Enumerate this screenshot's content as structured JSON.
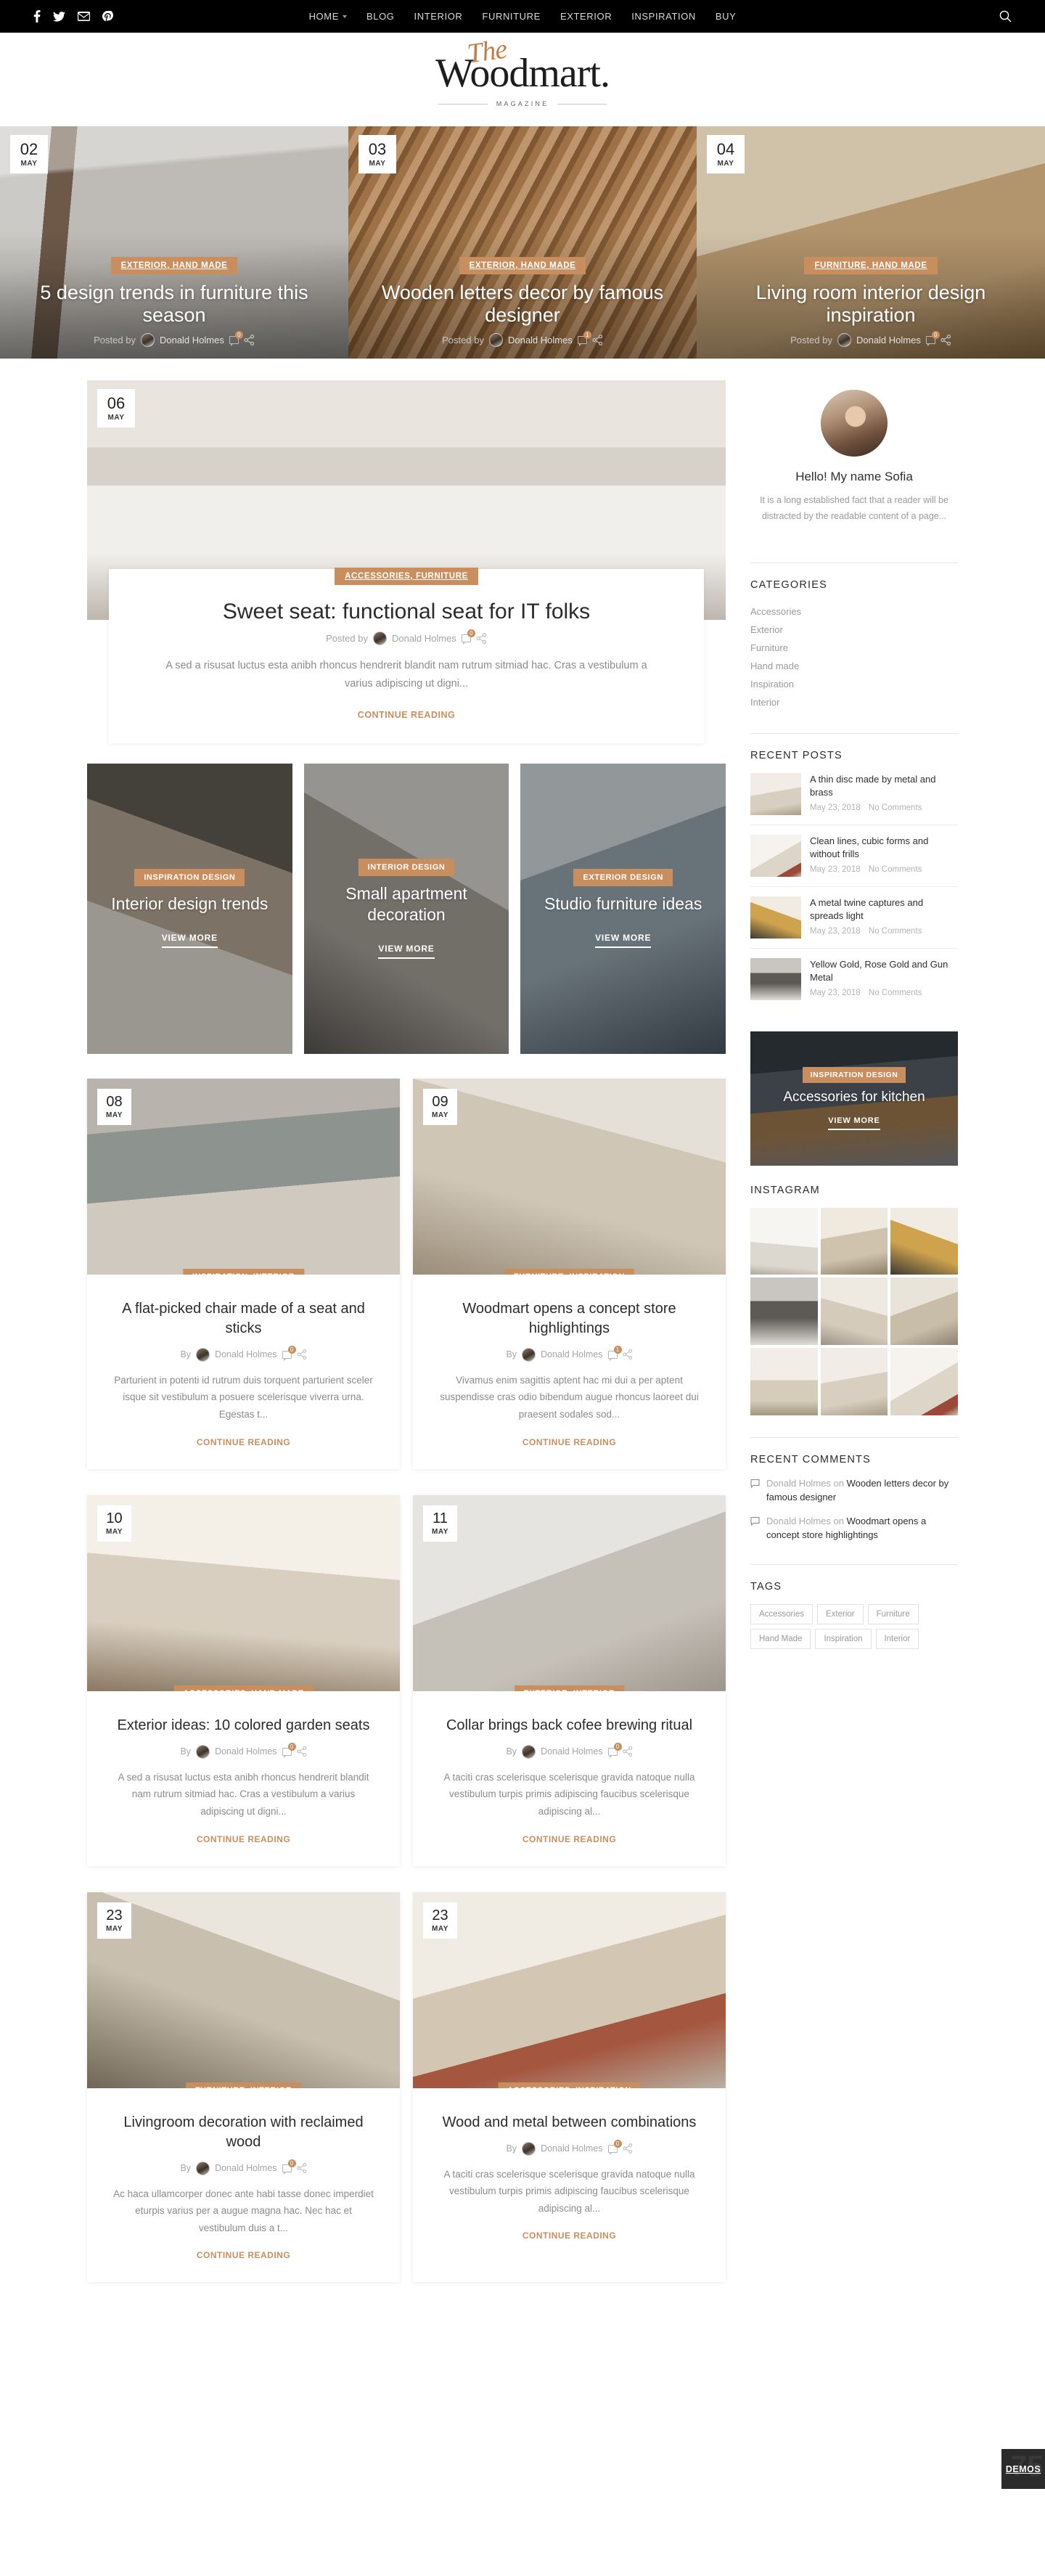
{
  "topbar": {
    "social": [
      {
        "name": "facebook-icon",
        "label": "Facebook"
      },
      {
        "name": "twitter-icon",
        "label": "Twitter"
      },
      {
        "name": "email-icon",
        "label": "Email"
      },
      {
        "name": "pinterest-icon",
        "label": "Pinterest"
      }
    ],
    "nav": [
      {
        "label": "HOME",
        "has_dropdown": true
      },
      {
        "label": "BLOG",
        "has_dropdown": false
      },
      {
        "label": "INTERIOR",
        "has_dropdown": false
      },
      {
        "label": "FURNITURE",
        "has_dropdown": false
      },
      {
        "label": "EXTERIOR",
        "has_dropdown": false
      },
      {
        "label": "INSPIRATION",
        "has_dropdown": false
      },
      {
        "label": "BUY",
        "has_dropdown": false
      }
    ],
    "search_icon": "search-icon"
  },
  "logo": {
    "script": "The",
    "main": "Woodmart.",
    "sub": "MAGAZINE"
  },
  "hero_slides": [
    {
      "day": "02",
      "month": "MAY",
      "category": "EXTERIOR, HAND MADE",
      "title": "5 design trends in furniture this season",
      "posted_label": "Posted by",
      "author": "Donald Holmes",
      "comments": "0"
    },
    {
      "day": "03",
      "month": "MAY",
      "category": "EXTERIOR, HAND MADE",
      "title": "Wooden letters decor by famous designer",
      "posted_label": "Posted by",
      "author": "Donald Holmes",
      "comments": "1"
    },
    {
      "day": "04",
      "month": "MAY",
      "category": "FURNITURE, HAND MADE",
      "title": "Living room interior design inspiration",
      "posted_label": "Posted by",
      "author": "Donald Holmes",
      "comments": "0"
    }
  ],
  "featured": {
    "day": "06",
    "month": "MAY",
    "category": "ACCESSORIES, FURNITURE",
    "title": "Sweet seat: functional seat for IT folks",
    "posted_label": "Posted by",
    "author": "Donald Holmes",
    "comments": "0",
    "excerpt": "A sed a risusat luctus esta anibh rhoncus hendrerit blandit nam rutrum sitmiad hac. Cras a vestibulum a varius adipiscing ut digni...",
    "continue_label": "CONTINUE READING"
  },
  "promos": [
    {
      "badge": "INSPIRATION DESIGN",
      "title": "Interior design trends",
      "cta": "VIEW MORE"
    },
    {
      "badge": "INTERIOR DESIGN",
      "title": "Small apartment decoration",
      "cta": "VIEW MORE"
    },
    {
      "badge": "EXTERIOR DESIGN",
      "title": "Studio furniture ideas",
      "cta": "VIEW MORE"
    }
  ],
  "posts": [
    {
      "day": "08",
      "month": "MAY",
      "category": "INSPIRATION, INTERIOR",
      "title": "A flat-picked chair made of a seat and sticks",
      "by_label": "By",
      "author": "Donald Holmes",
      "comments": "0",
      "excerpt": "Parturient in potenti id rutrum duis torquent parturient sceler isque sit vestibulum a posuere scelerisque viverra urna. Egestas t...",
      "continue_label": "CONTINUE READING"
    },
    {
      "day": "09",
      "month": "MAY",
      "category": "FURNITURE, INSPIRATION",
      "title": "Woodmart opens a concept store highlightings",
      "by_label": "By",
      "author": "Donald Holmes",
      "comments": "1",
      "excerpt": "Vivamus enim sagittis aptent hac mi dui a per aptent suspendisse cras odio bibendum augue rhoncus laoreet dui praesent sodales sod...",
      "continue_label": "CONTINUE READING"
    },
    {
      "day": "10",
      "month": "MAY",
      "category": "ACCESSORIES, HAND MADE",
      "title": "Exterior ideas: 10 colored garden seats",
      "by_label": "By",
      "author": "Donald Holmes",
      "comments": "0",
      "excerpt": "A sed a risusat luctus esta anibh rhoncus hendrerit blandit nam rutrum sitmiad hac. Cras a vestibulum a varius adipiscing ut digni...",
      "continue_label": "CONTINUE READING"
    },
    {
      "day": "11",
      "month": "MAY",
      "category": "EXTERIOR, INTERIOR",
      "title": "Collar brings back cofee brewing ritual",
      "by_label": "By",
      "author": "Donald Holmes",
      "comments": "0",
      "excerpt": "A taciti cras scelerisque scelerisque gravida natoque nulla vestibulum turpis primis adipiscing faucibus scelerisque adipiscing al...",
      "continue_label": "CONTINUE READING"
    },
    {
      "day": "23",
      "month": "MAY",
      "category": "FURNITURE, INTERIOR",
      "title": "Livingroom decoration with reclaimed wood",
      "by_label": "By",
      "author": "Donald Holmes",
      "comments": "0",
      "excerpt": "Ac haca ullamcorper donec ante habi tasse donec imperdiet eturpis varius per a augue magna hac. Nec hac et vestibulum duis a t...",
      "continue_label": "CONTINUE READING"
    },
    {
      "day": "23",
      "month": "MAY",
      "category": "ACCESSORIES, INSPIRATION",
      "title": "Wood and metal between combinations",
      "by_label": "By",
      "author": "Donald Holmes",
      "comments": "0",
      "excerpt": "A taciti cras scelerisque scelerisque gravida natoque nulla vestibulum turpis primis adipiscing faucibus scelerisque adipiscing al...",
      "continue_label": "CONTINUE READING"
    }
  ],
  "sidebar": {
    "about": {
      "name": "Hello! My name Sofia",
      "text": "It is a long established fact that a reader will be distracted by the readable content of a page..."
    },
    "categories": {
      "title": "CATEGORIES",
      "items": [
        "Accessories",
        "Exterior",
        "Furniture",
        "Hand made",
        "Inspiration",
        "Interior"
      ]
    },
    "recent_posts": {
      "title": "RECENT POSTS",
      "items": [
        {
          "title": "A thin disc made by metal and brass",
          "date": "May 23, 2018",
          "comments": "No Comments"
        },
        {
          "title": "Clean lines, cubic forms and without frills",
          "date": "May 23, 2018",
          "comments": "No Comments"
        },
        {
          "title": "A metal twine captures and spreads light",
          "date": "May 23, 2018",
          "comments": "No Comments"
        },
        {
          "title": "Yellow Gold, Rose Gold and Gun Metal",
          "date": "May 23, 2018",
          "comments": "No Comments"
        }
      ]
    },
    "side_promo": {
      "badge": "INSPIRATION DESIGN",
      "title": "Accessories for kitchen",
      "cta": "VIEW MORE"
    },
    "instagram": {
      "title": "INSTAGRAM",
      "count": 9
    },
    "recent_comments": {
      "title": "RECENT COMMENTS",
      "items": [
        {
          "who": "Donald Holmes",
          "on": "on",
          "post": "Wooden letters decor by famous designer"
        },
        {
          "who": "Donald Holmes",
          "on": "on",
          "post": "Woodmart opens a concept store highlightings"
        }
      ]
    },
    "tags": {
      "title": "TAGS",
      "items": [
        "Accessories",
        "Exterior",
        "Furniture",
        "Hand Made",
        "Inspiration",
        "Interior"
      ]
    }
  },
  "demos_button": {
    "label": "DEMOS",
    "count": "75"
  },
  "colors": {
    "accent": "#c98e5e",
    "dark": "#000000",
    "text": "#2b2b2b",
    "muted": "#9a9a9a"
  }
}
